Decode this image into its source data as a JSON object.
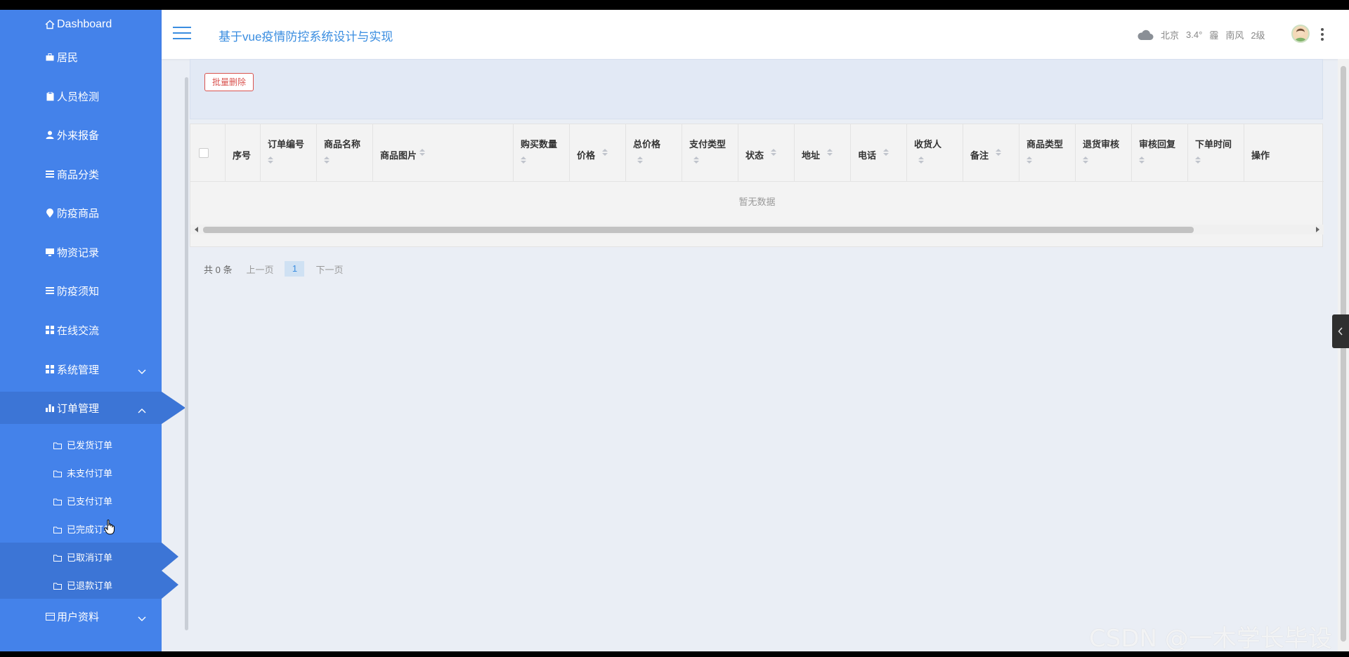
{
  "sidebar": {
    "items": [
      {
        "label": "Dashboard",
        "icon": "home-icon"
      },
      {
        "label": "居民",
        "icon": "briefcase-icon"
      },
      {
        "label": "人员检测",
        "icon": "clipboard-icon"
      },
      {
        "label": "外来报备",
        "icon": "user-icon"
      },
      {
        "label": "商品分类",
        "icon": "list-icon"
      },
      {
        "label": "防疫商品",
        "icon": "map-pin-icon"
      },
      {
        "label": "物资记录",
        "icon": "monitor-icon"
      },
      {
        "label": "防疫须知",
        "icon": "list-icon"
      },
      {
        "label": "在线交流",
        "icon": "grid-icon"
      },
      {
        "label": "系统管理",
        "icon": "grid-icon"
      },
      {
        "label": "订单管理",
        "icon": "bar-chart-icon"
      },
      {
        "label": "用户资料",
        "icon": "card-icon"
      }
    ],
    "order_submenu": [
      {
        "label": "已发货订单"
      },
      {
        "label": "未支付订单"
      },
      {
        "label": "已支付订单"
      },
      {
        "label": "已完成订单"
      },
      {
        "label": "已取消订单"
      },
      {
        "label": "已退款订单"
      }
    ]
  },
  "header": {
    "title": "基于vue疫情防控系统设计与实现",
    "weather": {
      "city": "北京",
      "temp": "3.4°",
      "aqi": "霾",
      "wind": "南风",
      "level": "2级"
    }
  },
  "toolbar": {
    "batch_delete": "批量删除"
  },
  "table": {
    "columns": [
      "序号",
      "订单编号",
      "商品名称",
      "商品图片",
      "购买数量",
      "价格",
      "总价格",
      "支付类型",
      "状态",
      "地址",
      "电话",
      "收货人",
      "备注",
      "商品类型",
      "退货审核",
      "审核回复",
      "下单时间",
      "操作"
    ],
    "empty": "暂无数据"
  },
  "pager": {
    "total": "共 0 条",
    "prev": "上一页",
    "page": "1",
    "next": "下一页"
  },
  "watermark": "CSDN @一木学长毕设",
  "colors": {
    "sidebar": "#4482ea",
    "accent": "#3a8de0",
    "danger": "#d9534f"
  }
}
